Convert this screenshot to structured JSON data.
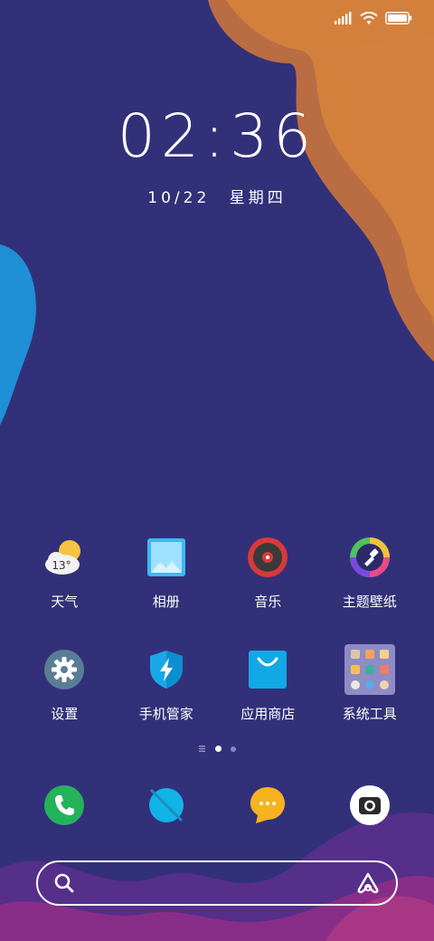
{
  "status_bar": {
    "icons": [
      "signal-icon",
      "wifi-icon",
      "battery-icon"
    ],
    "battery_color": "#5ab4ff"
  },
  "lock": {
    "time": "02:36",
    "date": "10/22",
    "weekday": "星期四"
  },
  "apps": [
    {
      "label": "天气",
      "icon": "weather-icon",
      "temp": "13°"
    },
    {
      "label": "相册",
      "icon": "gallery-icon"
    },
    {
      "label": "音乐",
      "icon": "music-icon"
    },
    {
      "label": "主题壁纸",
      "icon": "theme-icon"
    },
    {
      "label": "设置",
      "icon": "settings-icon"
    },
    {
      "label": "手机管家",
      "icon": "phone-manager-icon"
    },
    {
      "label": "应用商店",
      "icon": "app-store-icon"
    },
    {
      "label": "系统工具",
      "icon": "system-tools-folder-icon"
    }
  ],
  "pager": {
    "pages": 3,
    "active": 1
  },
  "dock": [
    {
      "icon": "phone-icon"
    },
    {
      "icon": "browser-icon"
    },
    {
      "icon": "messages-icon"
    },
    {
      "icon": "camera-icon"
    }
  ],
  "search": {
    "placeholder": "",
    "value": ""
  },
  "colors": {
    "background": "#33307a",
    "accent_orange": "#c9743c",
    "accent_blue": "#1f8fd6",
    "accent_magenta": "#8e2f8a"
  }
}
